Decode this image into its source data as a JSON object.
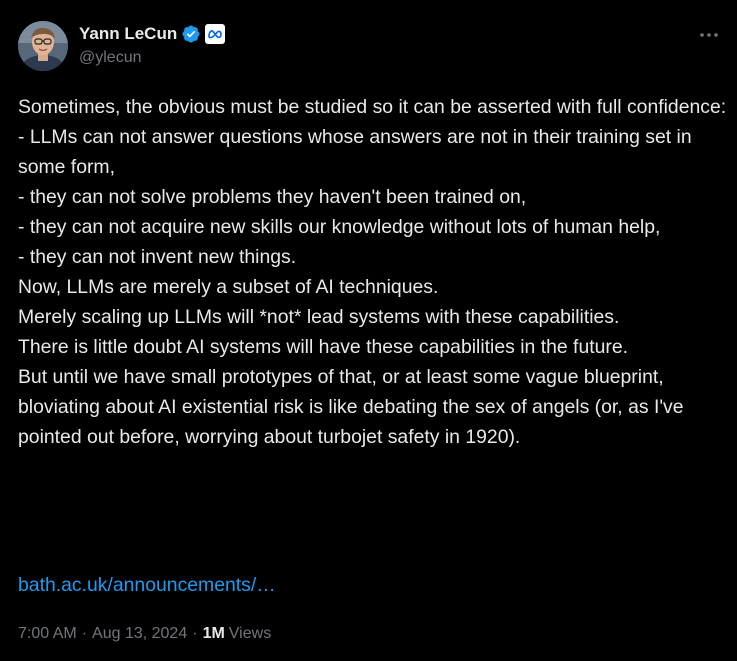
{
  "author": {
    "display_name": "Yann LeCun",
    "handle": "@ylecun",
    "verified_icon": "verified-badge-icon",
    "affiliation_icon": "meta-logo-icon"
  },
  "tweet": {
    "text": "Sometimes, the obvious must be studied so it can be asserted with full confidence:\n- LLMs can not answer questions whose answers are not in their training set in some form,\n- they can not solve problems they haven't been trained on,\n- they can not acquire new skills our knowledge without lots of human help,\n- they can not invent new things.\nNow, LLMs are merely a subset of AI techniques.\nMerely scaling up LLMs will *not* lead systems with these capabilities.\nThere is little doubt AI systems will have these capabilities in the future.\nBut until we have small prototypes of that, or at least some vague blueprint, bloviating about AI existential risk is like debating the sex of angels (or, as I've pointed out before, worrying about turbojet safety in 1920).",
    "link": "bath.ac.uk/announcements/…"
  },
  "meta": {
    "time": "7:00 AM",
    "separator": "·",
    "date": "Aug 13, 2024",
    "views_count": "1M",
    "views_label": "Views"
  },
  "colors": {
    "background": "#000000",
    "text": "#e7e9ea",
    "secondary": "#71767b",
    "accent": "#1d9bf0"
  }
}
